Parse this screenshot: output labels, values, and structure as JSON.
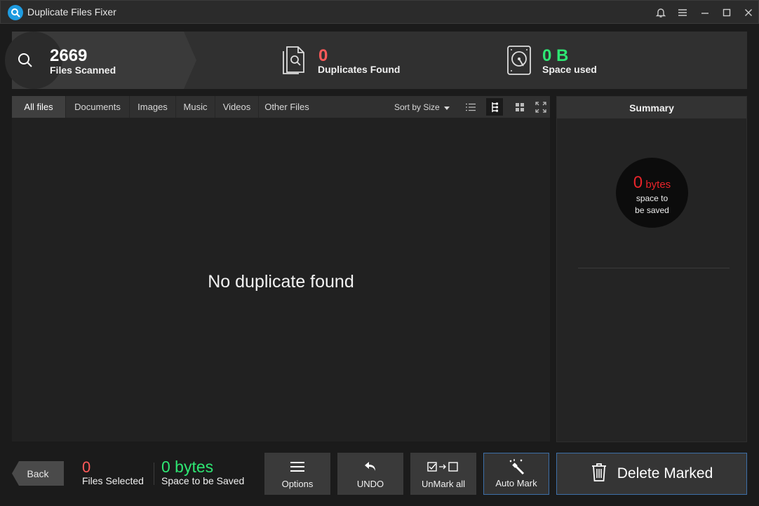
{
  "window": {
    "title": "Duplicate Files Fixer",
    "controls": [
      "bell-icon",
      "menu-icon",
      "minimize-icon",
      "maximize-icon",
      "close-icon"
    ]
  },
  "stats": {
    "scanned": {
      "value": "2669",
      "label": "Files Scanned",
      "icon": "search-icon"
    },
    "duplicates": {
      "value": "0",
      "label": "Duplicates Found",
      "icon": "document-search-icon",
      "color": "#ff5a5a"
    },
    "space": {
      "value": "0 B",
      "label": "Space used",
      "icon": "hard-drive-icon",
      "color": "#2ee673"
    }
  },
  "tabs": [
    {
      "label": "All files",
      "active": true
    },
    {
      "label": "Documents",
      "active": false
    },
    {
      "label": "Images",
      "active": false
    },
    {
      "label": "Music",
      "active": false
    },
    {
      "label": "Videos",
      "active": false
    },
    {
      "label": "Other Files",
      "active": false
    }
  ],
  "sort": {
    "label": "Sort by Size"
  },
  "view_modes": [
    "list-view-icon",
    "tree-view-icon",
    "grid-view-icon",
    "expand-icon"
  ],
  "main": {
    "empty_message": "No duplicate found"
  },
  "summary": {
    "title": "Summary",
    "value_num": "0",
    "value_unit": "bytes",
    "label_line1": "space to",
    "label_line2": "be saved"
  },
  "footer": {
    "back_label": "Back",
    "files_selected_value": "0",
    "files_selected_label": "Files Selected",
    "space_saved_value": "0 bytes",
    "space_saved_label": "Space to be Saved",
    "buttons": {
      "options": "Options",
      "undo": "UNDO",
      "unmark": "UnMark all",
      "automark": "Auto Mark"
    },
    "delete_label": "Delete Marked"
  },
  "colors": {
    "accent_red": "#e8242a",
    "accent_green": "#2ee673",
    "accent_blue": "#3d6fa8"
  }
}
